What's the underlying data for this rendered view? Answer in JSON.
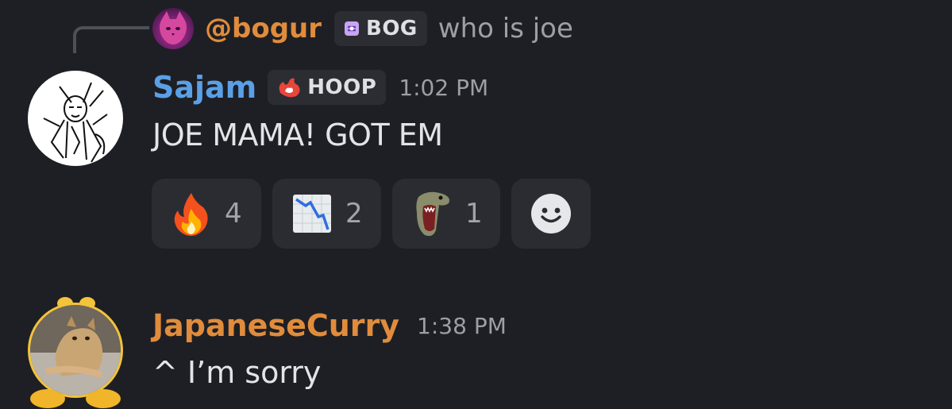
{
  "reply": {
    "author": "@bogur",
    "tag": "BOG",
    "text": "who is joe"
  },
  "messages": [
    {
      "author": "Sajam",
      "tag": "HOOP",
      "timestamp": "1:02 PM",
      "text": "JOE MAMA! GOT EM",
      "reactions": [
        {
          "emoji": "fire-emoji",
          "count": "4"
        },
        {
          "emoji": "chart-decreasing-emoji",
          "count": "2"
        },
        {
          "emoji": "dinosaur-screaming-emoji",
          "count": "1"
        }
      ]
    },
    {
      "author": "JapaneseCurry",
      "timestamp": "1:38 PM",
      "text": "^ I’m sorry"
    }
  ],
  "colors": {
    "background": "#1e1f24",
    "bogur_name": "#e08c3c",
    "sajam_name": "#5aa0e6",
    "curry_name": "#e08c3c",
    "reaction_bg": "#2b2c32"
  }
}
